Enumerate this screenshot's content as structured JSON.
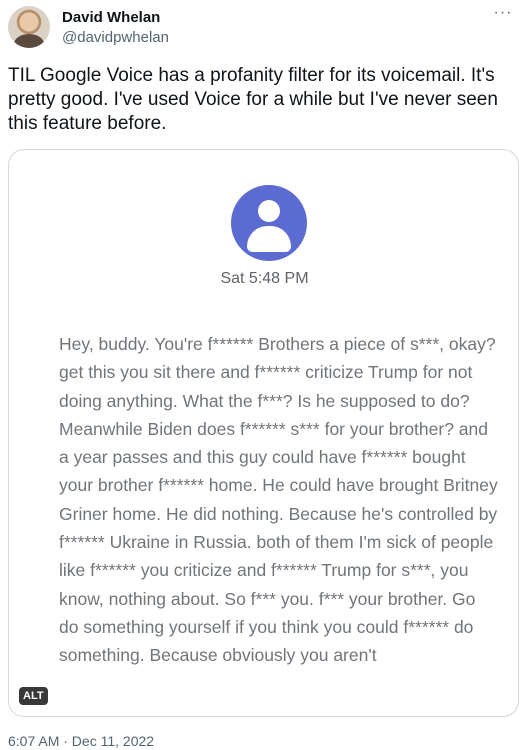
{
  "author": {
    "display_name": "David Whelan",
    "handle": "@davidpwhelan"
  },
  "tweet": {
    "text": "TIL Google Voice has a profanity filter for its voicemail. It's pretty good. I've used Voice for a while but I've never seen this feature before."
  },
  "media": {
    "voicemail_time": "Sat 5:48 PM",
    "transcript": "Hey, buddy. You're f****** Brothers a piece of s***, okay? get this you sit there and f****** criticize Trump for not doing anything. What the f***? Is he supposed to do? Meanwhile Biden does f****** s*** for your brother? and a year passes and this guy could have f****** bought your brother f****** home. He could have brought Britney Griner home. He did nothing. Because he's controlled by f****** Ukraine in Russia. both of them I'm sick of people like f****** you criticize and f****** Trump for s***, you know, nothing about. So f*** you. f*** your brother. Go do something yourself if you think you could f****** do something. Because obviously you aren't",
    "alt_badge": "ALT"
  },
  "meta": {
    "timestamp": "6:07 AM · Dec 11, 2022"
  },
  "icons": {
    "more": "more-options-icon",
    "avatar": "user-avatar-icon"
  },
  "colors": {
    "voicemail_avatar": "#5b6bd1",
    "transcript_text": "#70757a",
    "secondary_text": "#536471"
  }
}
